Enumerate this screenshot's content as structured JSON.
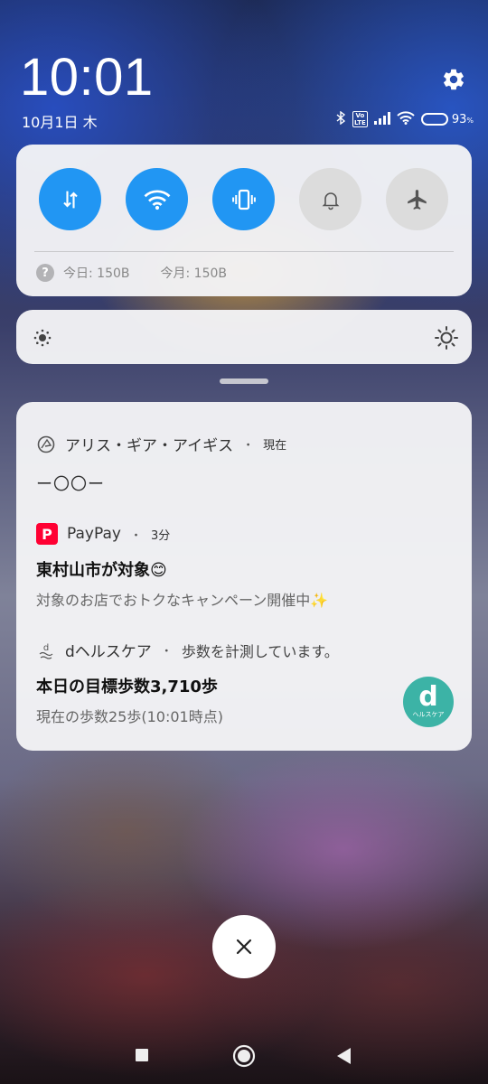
{
  "header": {
    "time": "10:01",
    "date": "10月1日 木",
    "battery_level": 0.93,
    "battery_text": "93",
    "battery_unit": "%",
    "volte_label": "Vo\nLTE"
  },
  "quick_settings": {
    "toggles": [
      {
        "name": "mobile-data",
        "state": "on"
      },
      {
        "name": "wifi",
        "state": "on"
      },
      {
        "name": "vibrate",
        "state": "on"
      },
      {
        "name": "ring",
        "state": "off"
      },
      {
        "name": "airplane",
        "state": "off"
      }
    ],
    "usage_today": "今日: 150B",
    "usage_month": "今月: 150B",
    "help_glyph": "?"
  },
  "brightness": {
    "level": 0.0
  },
  "notifications": {
    "alice": {
      "app": "アリス・ギア・アイギス",
      "time": "現在",
      "text": "ー〇〇ー"
    },
    "paypay": {
      "app": "PayPay",
      "time": "3分",
      "logo_glyph": "P",
      "title": "東村山市が対象😊",
      "text": "対象のお店でおトクなキャンペーン開催中✨"
    },
    "dhealth": {
      "app": "dヘルスケア",
      "subtitle": "歩数を計測しています。",
      "title": "本日の目標歩数3,710歩",
      "text": "現在の歩数25歩(10:01時点)",
      "thumb_letter": "d",
      "thumb_caption": "ヘルスケア"
    },
    "separator": "・"
  },
  "colors": {
    "toggle_on": "#2196f3",
    "toggle_off": "#dcdcdc",
    "paypay_red": "#ff0033",
    "dhealth_teal": "#3cb3a6"
  }
}
